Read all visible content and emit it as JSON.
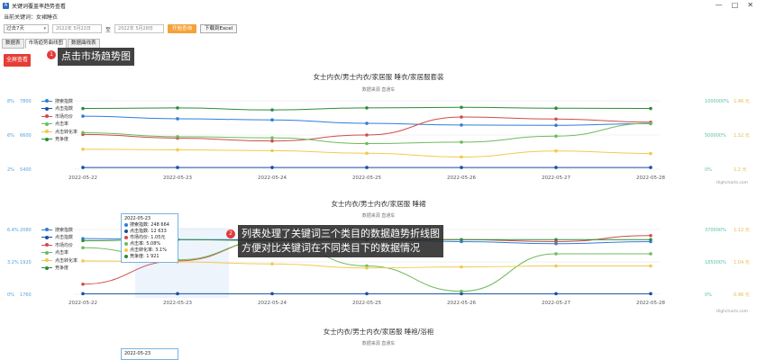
{
  "window": {
    "title": "关键词覆盖率趋势查看",
    "controls": [
      "—",
      "□",
      "✕"
    ]
  },
  "keyword_line": "当前关键词：女裙睡衣",
  "filters": {
    "range_select": "过去7天",
    "start_date": "2022年 5月22日",
    "to_label": "至",
    "end_date": "2022年 5月28日",
    "query_button": "开始查询",
    "download_button": "下载到Excel"
  },
  "tabs": [
    {
      "label": "数据表",
      "active": false
    },
    {
      "label": "市场趋势曲线图",
      "active": true
    },
    {
      "label": "数据曲线表",
      "active": false
    }
  ],
  "expand_button": "全屏查看",
  "callouts": [
    {
      "number": "1",
      "lines": [
        "点击市场趋势图"
      ]
    },
    {
      "number": "2",
      "lines": [
        "列表处理了关键词三个类目的数据趋势折线图",
        "方便对比关键词在不同类目下的数据情况"
      ]
    }
  ],
  "legend": [
    "搜索指数",
    "点击指数",
    "市场均价",
    "点击率",
    "点击转化率",
    "竞争度"
  ],
  "colors": {
    "series": [
      "#2f7ed8",
      "#1a4fa3",
      "#d14b4b",
      "#6dbb5c",
      "#f2c94c",
      "#2e8b3a"
    ],
    "axis_left": "#5aa0d8",
    "axis_right": "#e6b94a",
    "callout_dot": "#e33a3a",
    "expand_button": "#e63d36",
    "query_button": "#f6a23a"
  },
  "chart_data": [
    {
      "type": "line",
      "title": "女士内衣/男士内衣/家居服 睡衣/家居服套装",
      "subtitle": "数据来源 直通车",
      "credit": "Highcharts.com",
      "categories": [
        "2022-05-22",
        "2022-05-23",
        "2022-05-24",
        "2022-05-25",
        "2022-05-26",
        "2022-05-27",
        "2022-05-28"
      ],
      "left_axis_ticks": [
        "8%",
        "6%",
        "2%"
      ],
      "left_axis2_ticks": [
        "7800",
        "6600",
        "5400"
      ],
      "right_axis_ticks": [
        "1000000%",
        "500000%",
        "0%"
      ],
      "right_axis2_ticks": [
        "1.46 元",
        "1.32 元",
        "1.2 元"
      ],
      "series": [
        {
          "name": "搜索指数",
          "values": [
            7260,
            7170,
            7130,
            7010,
            6950,
            6940,
            7000
          ]
        },
        {
          "name": "点击指数",
          "values": [
            5460,
            5460,
            5460,
            5460,
            5460,
            5460,
            5460
          ]
        },
        {
          "name": "市场均价",
          "values": [
            6620,
            6490,
            6390,
            6600,
            7230,
            7160,
            7050
          ]
        },
        {
          "name": "点击率",
          "values": [
            6680,
            6540,
            6500,
            6300,
            6350,
            6560,
            7010
          ]
        },
        {
          "name": "点击转化率",
          "values": [
            6100,
            6080,
            6050,
            5960,
            5830,
            6040,
            5950
          ]
        },
        {
          "name": "竞争度",
          "values": [
            7530,
            7550,
            7480,
            7550,
            7570,
            7540,
            7530
          ]
        }
      ],
      "ylim": [
        5400,
        7800
      ]
    },
    {
      "type": "line",
      "title": "女士内衣/男士内衣/家居服 睡裙",
      "subtitle": "数据来源 直通车",
      "credit": "Highcharts.com",
      "categories": [
        "2022-05-22",
        "2022-05-23",
        "2022-05-24",
        "2022-05-25",
        "2022-05-26",
        "2022-05-27",
        "2022-05-28"
      ],
      "left_axis_ticks": [
        "6.4%",
        "3.2%",
        "0%"
      ],
      "left_axis2_ticks": [
        "2080",
        "1920",
        "1760"
      ],
      "right_axis_ticks": [
        "370000%",
        "185000%",
        "0%"
      ],
      "right_axis2_ticks": [
        "1.12 元",
        "1.04 元",
        "0.96 元"
      ],
      "series": [
        {
          "name": "搜索指数",
          "values": [
            2035,
            2030,
            2030,
            2030,
            2020,
            2010,
            2020
          ]
        },
        {
          "name": "点击指数",
          "values": [
            1763,
            1763,
            1763,
            1763,
            1763,
            1763,
            1763
          ]
        },
        {
          "name": "市场均价",
          "values": [
            1810,
            1925,
            2030,
            2030,
            2030,
            2020,
            2050
          ]
        },
        {
          "name": "点击率",
          "values": [
            1990,
            1930,
            2030,
            1900,
            1775,
            1960,
            1960
          ]
        },
        {
          "name": "点击转化率",
          "values": [
            1925,
            1920,
            1910,
            1890,
            1895,
            1900,
            1900
          ]
        },
        {
          "name": "竞争度",
          "values": [
            2025,
            2030,
            2025,
            2030,
            2030,
            2030,
            2030
          ]
        }
      ],
      "ylim": [
        1760,
        2080
      ],
      "tooltip": {
        "date": "2022-05-23",
        "rows": [
          "搜索指数: 248 664",
          "点击指数: 12 633",
          "市场均价: 1.05元",
          "点击率: 5.08%",
          "点击转化率: 3.1%",
          "竞争度: 1 921"
        ]
      }
    },
    {
      "type": "line",
      "title": "女士内衣/男士内衣/家居服 睡袍/浴袍",
      "subtitle": "数据来源 直通车",
      "tooltip": {
        "date": "2022-05-23"
      }
    }
  ]
}
